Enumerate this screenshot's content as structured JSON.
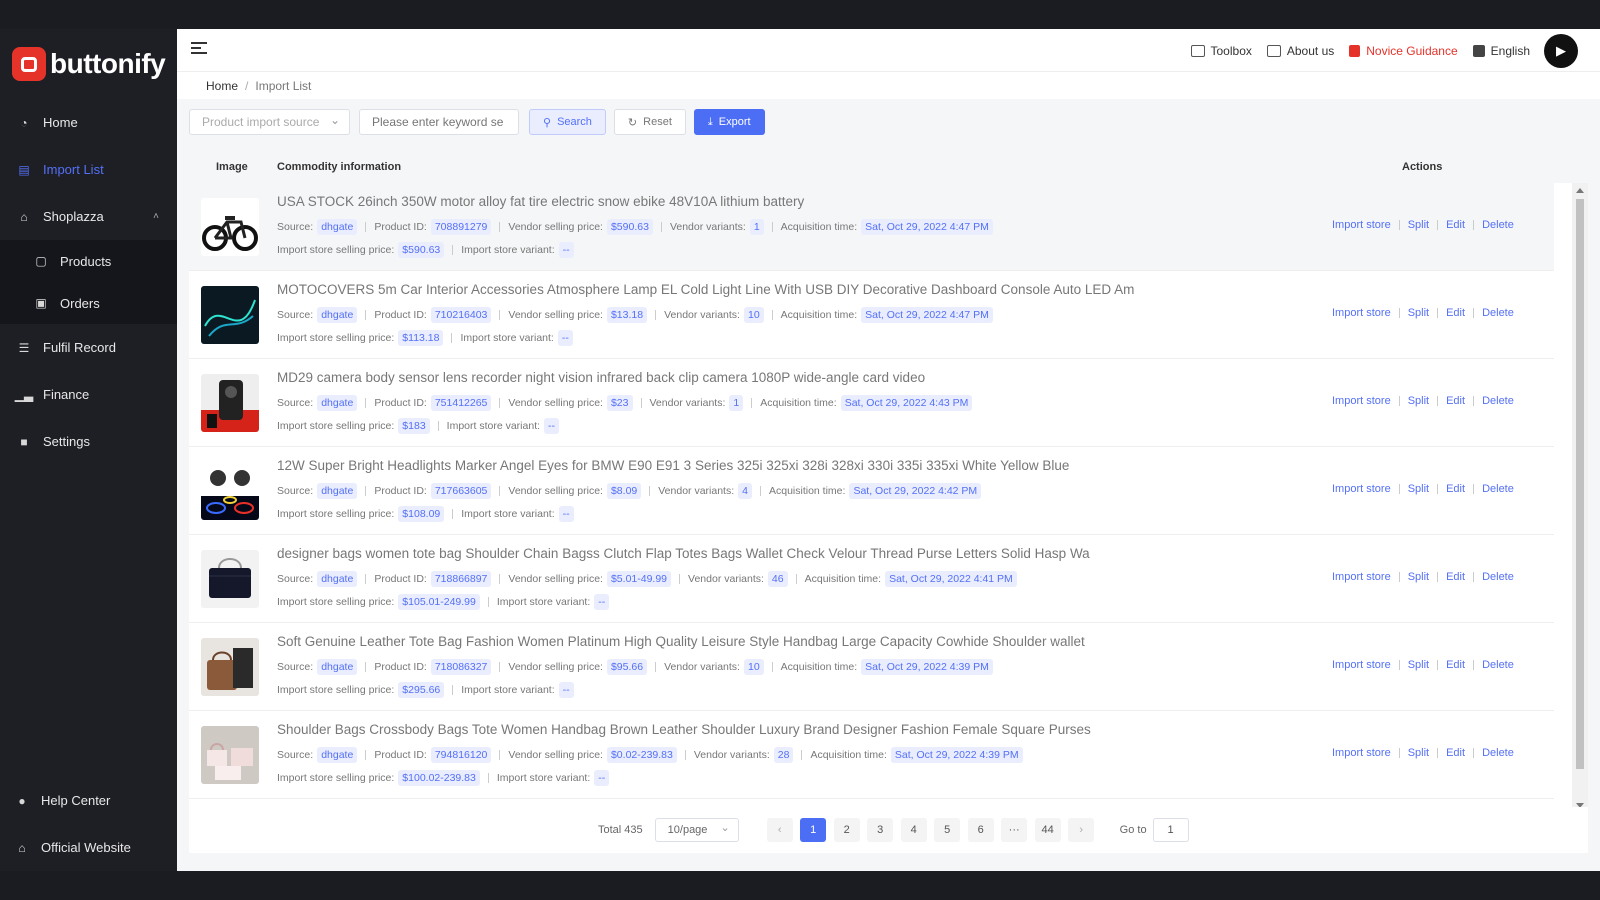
{
  "brand": {
    "name": "buttonify",
    "color": "#e5332a"
  },
  "sidebar": {
    "items": [
      {
        "label": "Home",
        "icon": "dashboard-icon"
      },
      {
        "label": "Import List",
        "icon": "clipboard-icon",
        "active": true
      },
      {
        "label": "Shoplazza",
        "icon": "shop-icon"
      }
    ],
    "sub_items": [
      {
        "label": "Products",
        "icon": "bag-icon"
      },
      {
        "label": "Orders",
        "icon": "orders-icon"
      }
    ],
    "items_after": [
      {
        "label": "Fulfil Record",
        "icon": "document-icon"
      },
      {
        "label": "Finance",
        "icon": "bar-chart-icon"
      },
      {
        "label": "Settings",
        "icon": "settings-icon"
      }
    ],
    "bottom": [
      {
        "label": "Help Center",
        "icon": "help-icon"
      },
      {
        "label": "Official Website",
        "icon": "home-icon"
      }
    ]
  },
  "header": {
    "toolbox": "Toolbox",
    "about": "About us",
    "novice": "Novice Guidance",
    "language": "English",
    "avatar_glyph": "▶"
  },
  "breadcrumb": {
    "home": "Home",
    "current": "Import List"
  },
  "filters": {
    "source_placeholder": "Product import source",
    "keyword_placeholder": "Please enter keyword se",
    "search": "Search",
    "reset": "Reset",
    "export": "Export"
  },
  "table": {
    "headers": {
      "image": "Image",
      "info": "Commodity information",
      "actions": "Actions"
    },
    "labels": {
      "source": "Source:",
      "product_id": "Product ID:",
      "vendor_price": "Vendor selling price:",
      "vendor_variants": "Vendor variants:",
      "acq_time": "Acquisition time:",
      "store_price": "Import store selling price:",
      "store_variant": "Import store variant:"
    },
    "actions": {
      "import": "Import store",
      "split": "Split",
      "edit": "Edit",
      "delete": "Delete"
    },
    "rows": [
      {
        "title": "USA STOCK 26inch 350W motor alloy fat tire electric snow ebike 48V10A lithium battery",
        "source": "dhgate",
        "product_id": "708891279",
        "vendor_price": "$590.63",
        "vendor_variants": "1",
        "acq_time": "Sat, Oct 29, 2022 4:47 PM",
        "store_price": "$590.63",
        "store_variant": "--",
        "thumb": "ebike"
      },
      {
        "title": "MOTOCOVERS 5m Car Interior Accessories Atmosphere Lamp EL Cold Light Line With USB DIY Decorative Dashboard Console Auto LED Am",
        "source": "dhgate",
        "product_id": "710216403",
        "vendor_price": "$13.18",
        "vendor_variants": "10",
        "acq_time": "Sat, Oct 29, 2022 4:47 PM",
        "store_price": "$113.18",
        "store_variant": "--",
        "thumb": "led"
      },
      {
        "title": "MD29 camera body sensor lens recorder night vision infrared back clip camera 1080P wide-angle card video",
        "source": "dhgate",
        "product_id": "751412265",
        "vendor_price": "$23",
        "vendor_variants": "1",
        "acq_time": "Sat, Oct 29, 2022 4:43 PM",
        "store_price": "$183",
        "store_variant": "--",
        "thumb": "camera"
      },
      {
        "title": "12W Super Bright Headlights Marker Angel Eyes for BMW E90 E91 3 Series 325i 325xi 328i 328xi 330i 335i 335xi White Yellow Blue",
        "source": "dhgate",
        "product_id": "717663605",
        "vendor_price": "$8.09",
        "vendor_variants": "4",
        "acq_time": "Sat, Oct 29, 2022 4:42 PM",
        "store_price": "$108.09",
        "store_variant": "--",
        "thumb": "headlights"
      },
      {
        "title": "designer bags women tote bag Shoulder Chain Bagss Clutch Flap Totes Bags Wallet Check Velour Thread Purse Letters Solid Hasp Wa",
        "source": "dhgate",
        "product_id": "718866897",
        "vendor_price": "$5.01-49.99",
        "vendor_variants": "46",
        "acq_time": "Sat, Oct 29, 2022 4:41 PM",
        "store_price": "$105.01-249.99",
        "store_variant": "--",
        "thumb": "bag-black"
      },
      {
        "title": "Soft Genuine Leather Tote Bag Fashion Women Platinum High Quality Leisure Style Handbag Large Capacity Cowhide Shoulder wallet",
        "source": "dhgate",
        "product_id": "718086327",
        "vendor_price": "$95.66",
        "vendor_variants": "10",
        "acq_time": "Sat, Oct 29, 2022 4:39 PM",
        "store_price": "$295.66",
        "store_variant": "--",
        "thumb": "bag-brown"
      },
      {
        "title": "Shoulder Bags Crossbody Bags Tote Women Handbag Brown Leather Shoulder Luxury Brand Designer Fashion Female Square Purses",
        "source": "dhgate",
        "product_id": "794816120",
        "vendor_price": "$0.02-239.83",
        "vendor_variants": "28",
        "acq_time": "Sat, Oct 29, 2022 4:39 PM",
        "store_price": "$100.02-239.83",
        "store_variant": "--",
        "thumb": "bag-pink"
      }
    ]
  },
  "pagination": {
    "total": "Total 435",
    "page_size": "10/page",
    "prev": "‹",
    "next": "›",
    "pages": [
      "1",
      "2",
      "3",
      "4",
      "5",
      "6",
      "···",
      "44"
    ],
    "current": "1",
    "goto_label": "Go to",
    "goto_value": "1"
  }
}
